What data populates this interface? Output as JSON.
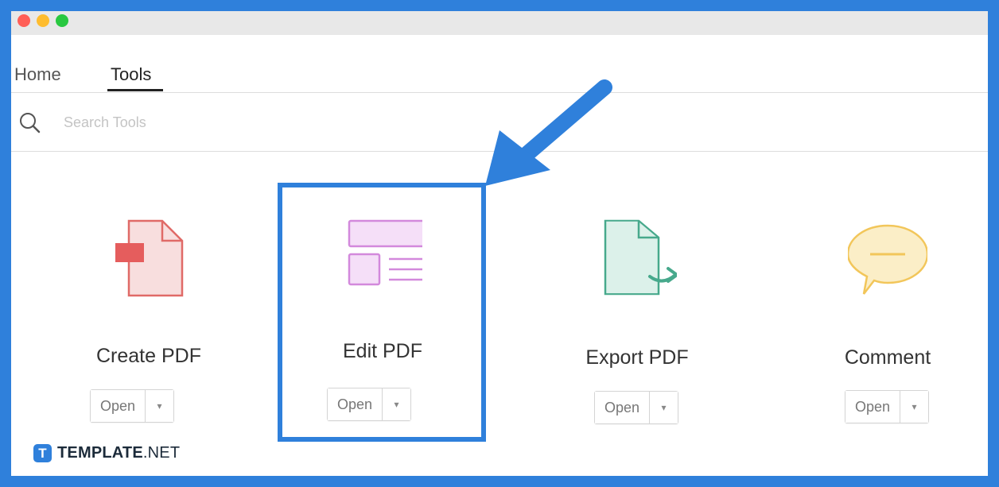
{
  "tabs": {
    "home": "Home",
    "tools": "Tools"
  },
  "search": {
    "placeholder": "Search Tools"
  },
  "tools": [
    {
      "name": "Create PDF",
      "icon": "create-pdf-icon",
      "open_label": "Open",
      "dropdown_glyph": "▾"
    },
    {
      "name": "Edit PDF",
      "icon": "edit-pdf-icon",
      "open_label": "Open",
      "dropdown_glyph": "▾"
    },
    {
      "name": "Export PDF",
      "icon": "export-pdf-icon",
      "open_label": "Open",
      "dropdown_glyph": "▾"
    },
    {
      "name": "Comment",
      "icon": "comment-icon",
      "open_label": "Open",
      "dropdown_glyph": "▾"
    }
  ],
  "brand": {
    "logo_letter": "T",
    "name_bold": "TEMPLATE",
    "name_suffix": ".NET"
  },
  "colors": {
    "annotation_blue": "#2f80db",
    "create_pdf_red": "#e06a67",
    "edit_pdf_purple": "#d389dc",
    "export_pdf_green": "#47a98c",
    "comment_yellow": "#f2c65a"
  }
}
